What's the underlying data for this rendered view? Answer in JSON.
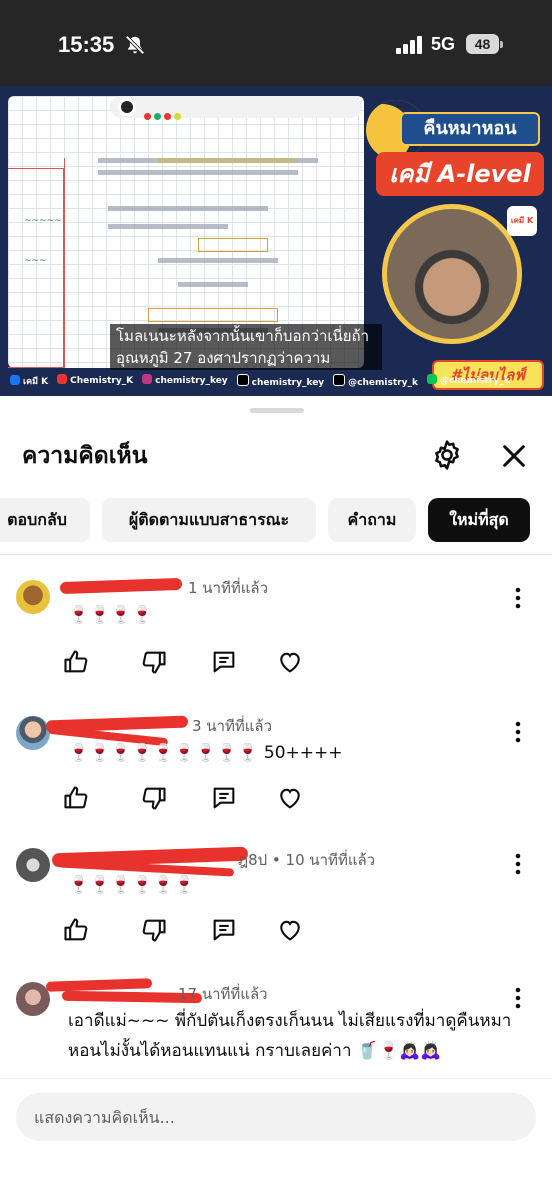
{
  "status_bar": {
    "time": "15:35",
    "network": "5G",
    "battery": "48"
  },
  "video": {
    "title_top": "คืนหมาหอน",
    "title_main": "เคมี A-level",
    "tag": "#ไม่ลบไลฟ์",
    "logo": "เคมี K",
    "caption": "โมลเนนะหลังจากนั้นเขาก็บอกว่าเนี่ยถ้าอุณหภูมิ 27 องศาปรากฏว่าความ",
    "socials": [
      "เคมี K",
      "Chemistry_K",
      "chemistry_key",
      "chemistry_key",
      "@chemistry_k",
      "@chemistry_k"
    ]
  },
  "comments_panel": {
    "title": "ความคิดเห็น",
    "chips": [
      "ตอบกลับ",
      "ผู้ติดตามแบบสาธารณะ",
      "คำถาม",
      "ใหม่ที่สุด"
    ],
    "active_chip": "ใหม่ที่สุด",
    "input_placeholder": "แสดงความคิดเห็น..."
  },
  "comments": [
    {
      "time": "1 นาทีที่แล้ว",
      "text": "🍷🍷🍷🍷"
    },
    {
      "time": "3 นาทีที่แล้ว",
      "text": "🍷🍷🍷🍷🍷🍷🍷🍷🍷 50++++"
    },
    {
      "time": "ฎ8ป • 10 นาทีที่แล้ว",
      "text": "🍷🍷🍷🍷🍷🍷"
    },
    {
      "time": "17 นาทีที่แล้ว",
      "text": "เอาดีแม่~~~ พี่กัปตันเก็งตรงเก็นนน ไม่เสียแรงที่มาดูคืนหมาหอนไม่งั้นได้หอนแทนแน่ กราบเลยค่าา 🥤🍷🙇🏻‍♀️🙇🏻‍♀️"
    }
  ],
  "colors": {
    "accent": "#0f0f0f",
    "redaction": "#e8322d",
    "secondary_text": "#606060"
  }
}
